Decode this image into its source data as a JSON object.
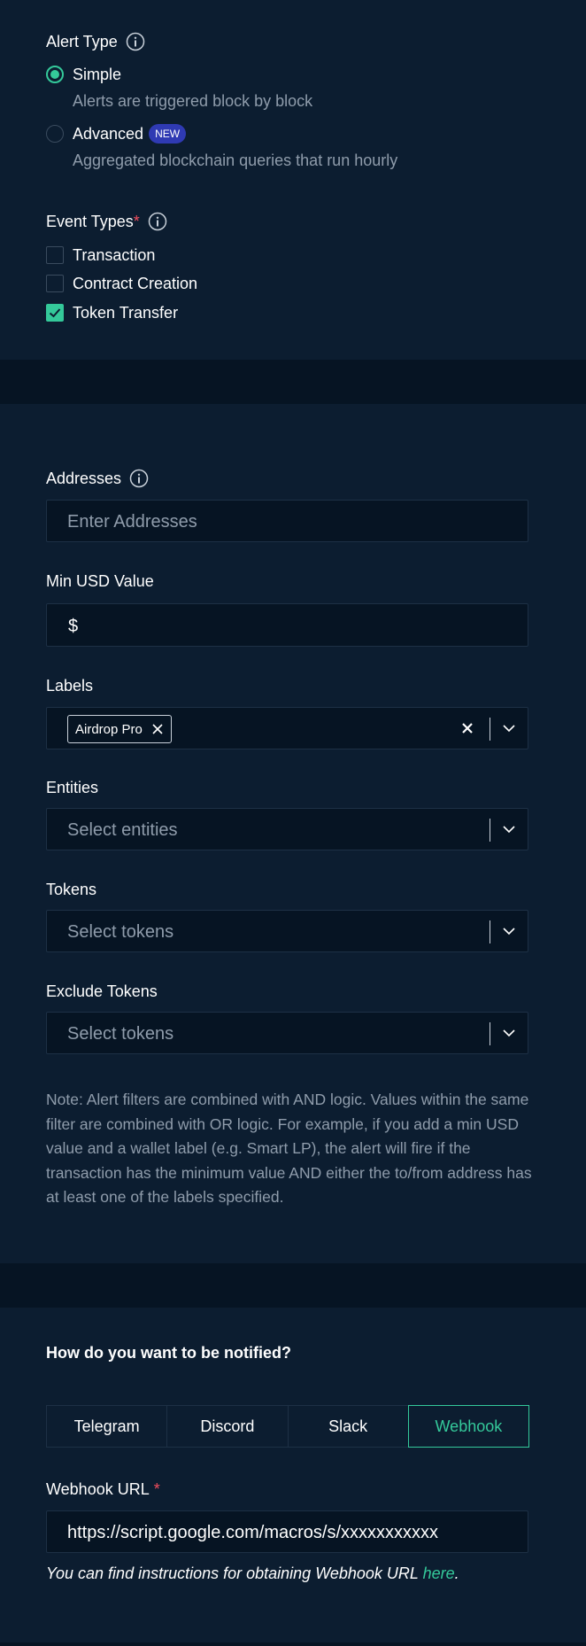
{
  "alert_type": {
    "label": "Alert Type",
    "options": [
      {
        "label": "Simple",
        "description": "Alerts are triggered block by block",
        "selected": true
      },
      {
        "label": "Advanced",
        "badge": "NEW",
        "description": "Aggregated blockchain queries that run hourly",
        "selected": false
      }
    ]
  },
  "event_types": {
    "label": "Event Types",
    "required_mark": "*",
    "options": [
      {
        "label": "Transaction",
        "checked": false
      },
      {
        "label": "Contract Creation",
        "checked": false
      },
      {
        "label": "Token Transfer",
        "checked": true
      }
    ]
  },
  "filters": {
    "addresses": {
      "label": "Addresses",
      "placeholder": "Enter Addresses"
    },
    "min_usd": {
      "label": "Min USD Value",
      "prefix": "$"
    },
    "labels": {
      "label": "Labels",
      "selected": [
        "Airdrop Pro"
      ]
    },
    "entities": {
      "label": "Entities",
      "placeholder": "Select entities"
    },
    "tokens": {
      "label": "Tokens",
      "placeholder": "Select tokens"
    },
    "exclude_tokens": {
      "label": "Exclude Tokens",
      "placeholder": "Select tokens"
    },
    "note": "Note: Alert filters are combined with AND logic. Values within the same filter are combined with OR logic. For example, if you add a min USD value and a wallet label (e.g. Smart LP), the alert will fire if the transaction has the minimum value AND either the to/from address has at least one of the labels specified."
  },
  "notification": {
    "heading": "How do you want to be notified?",
    "tabs": [
      "Telegram",
      "Discord",
      "Slack",
      "Webhook"
    ],
    "active_tab": "Webhook",
    "webhook_label": "Webhook URL",
    "required_mark": "*",
    "webhook_value": "https://script.google.com/macros/s/xxxxxxxxxxx",
    "help_prefix": "You can find instructions for obtaining Webhook URL ",
    "help_link": "here",
    "help_suffix": "."
  },
  "colors": {
    "background": "#061423",
    "panel": "#0c1d30",
    "accent": "#34c99a",
    "muted_text": "#8f9cab",
    "required": "#ef4d5d",
    "badge": "#2f3ab3"
  }
}
